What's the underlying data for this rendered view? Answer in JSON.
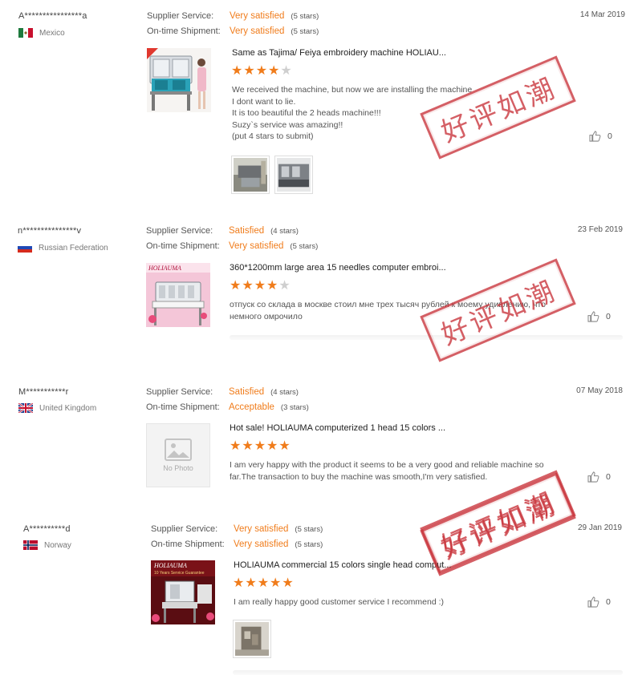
{
  "labels": {
    "supplier_service": "Supplier Service:",
    "ontime_shipment": "On-time Shipment:"
  },
  "stamp_text": "好评如潮",
  "no_photo_label": "No Photo",
  "reviews": [
    {
      "buyer": "A****************a",
      "country": "Mexico",
      "flag": "mexico-flag",
      "supplier_value": "Very satisfied",
      "supplier_stars": "(5 stars)",
      "shipment_value": "Very satisfied",
      "shipment_stars": "(5 stars)",
      "date": "14 Mar 2019",
      "product_title": "Same as Tajima/ Feiya embroidery machine HOLIAU...",
      "rating": 4,
      "text": "We received the machine, but now we are installing the machine\nI dont want to lie.\nIt is too beautiful the 2 heads machine!!!\nSuzy`s service was amazing!!\n(put 4 stars to submit)",
      "likes": "0"
    },
    {
      "buyer": "n***************v",
      "country": "Russian Federation",
      "flag": "russia-flag",
      "supplier_value": "Satisfied",
      "supplier_stars": "(4 stars)",
      "shipment_value": "Very satisfied",
      "shipment_stars": "(5 stars)",
      "date": "23 Feb 2019",
      "product_title": "360*1200mm large area 15 needles computer embroi...",
      "rating": 4,
      "text": "отпуск со склада в москве стоил мне трех тысяч рублей к моему удивлению, что немного омрочило",
      "likes": "0"
    },
    {
      "buyer": "M***********r",
      "country": "United Kingdom",
      "flag": "uk-flag",
      "supplier_value": "Satisfied",
      "supplier_stars": "(4 stars)",
      "shipment_value": "Acceptable",
      "shipment_stars": "(3 stars)",
      "date": "07 May 2018",
      "product_title": "Hot sale! HOLIAUMA computerized 1 head 15 colors ...",
      "rating": 5,
      "text": "I am very happy with the product it seems to be a very good and reliable machine so far.The transaction to buy the machine was smooth,I'm very satisfied.",
      "likes": "0"
    },
    {
      "buyer": "A**********d",
      "country": "Norway",
      "flag": "norway-flag",
      "supplier_value": "Very satisfied",
      "supplier_stars": "(5 stars)",
      "shipment_value": "Very satisfied",
      "shipment_stars": "(5 stars)",
      "date": "29 Jan 2019",
      "product_title": "HOLIAUMA commercial 15 colors single head comput...",
      "rating": 5,
      "text": "I am really happy good customer service I recommend :)",
      "likes": "0"
    }
  ]
}
